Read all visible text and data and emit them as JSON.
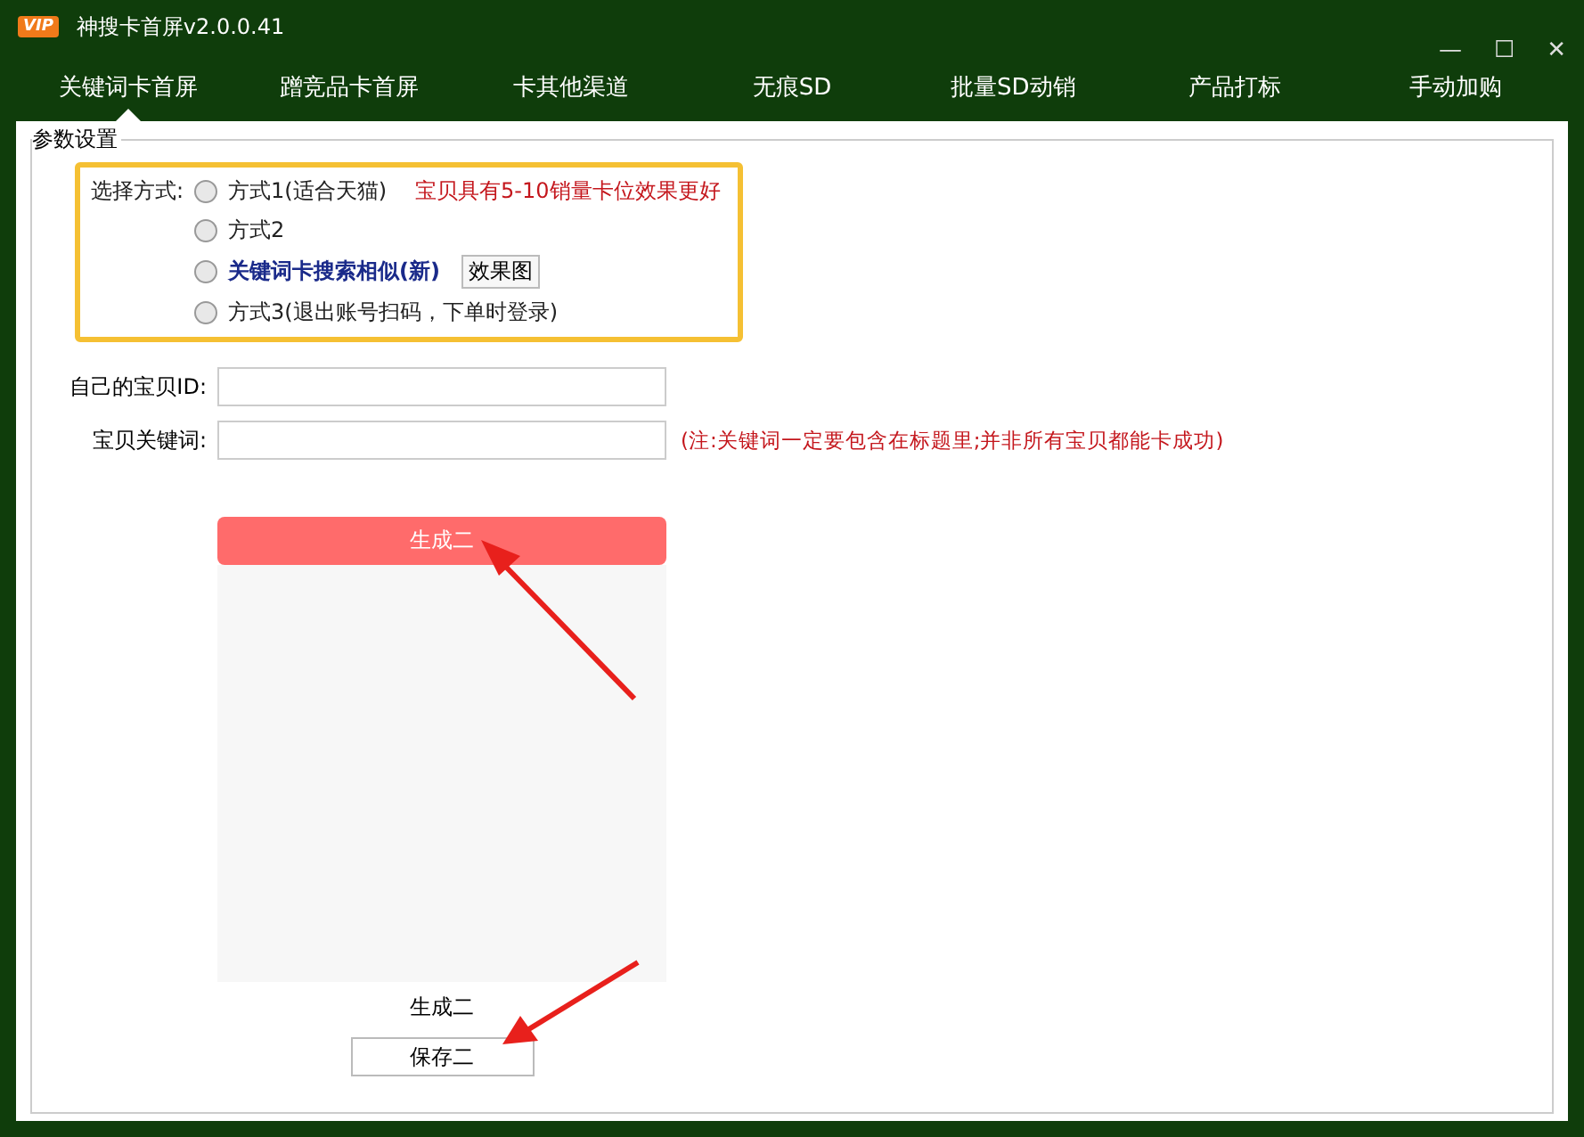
{
  "window": {
    "badge": "VIP",
    "title": "神搜卡首屏v2.0.0.41",
    "controls": [
      "—",
      "☐",
      "✕"
    ]
  },
  "tabs": [
    {
      "label": "关键词卡首屏",
      "selected": true
    },
    {
      "label": "蹭竞品卡首屏",
      "selected": false
    },
    {
      "label": "卡其他渠道",
      "selected": false
    },
    {
      "label": "无痕SD",
      "selected": false
    },
    {
      "label": "批量SD动销",
      "selected": false
    },
    {
      "label": "产品打标",
      "selected": false
    },
    {
      "label": "手动加购",
      "selected": false
    }
  ],
  "group": {
    "title": "参数设置",
    "method": {
      "label": "选择方式:",
      "options": [
        {
          "label": "方式1(适合天猫)",
          "selected": false,
          "bold": false,
          "note": "宝贝具有5-10销量卡位效果更好"
        },
        {
          "label": "方式2",
          "selected": false,
          "bold": false
        },
        {
          "label": "关键词卡搜索相似(新)",
          "selected": false,
          "bold": true,
          "button": "效果图"
        },
        {
          "label": "方式3(退出账号扫码，下单时登录)",
          "selected": false,
          "bold": false
        }
      ]
    },
    "fields": [
      {
        "label": "自己的宝贝ID:"
      },
      {
        "label": "宝贝关键词:",
        "note": "(注:关键词一定要包含在标题里;并非所有宝贝都能卡成功)"
      }
    ],
    "generate_button": "生成二",
    "caption": "生成二",
    "save_button": "保存二"
  }
}
